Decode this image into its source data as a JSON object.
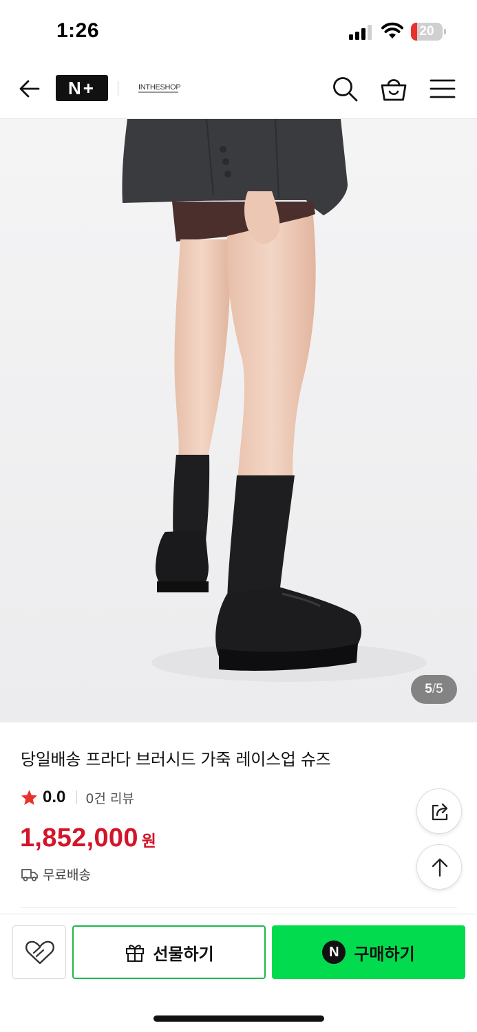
{
  "status_bar": {
    "time": "1:26",
    "battery_level": "20",
    "battery_fraction": 0.2,
    "icons": [
      "cellular-signal-icon",
      "wifi-icon",
      "battery-icon"
    ]
  },
  "nav": {
    "logo": "N+",
    "shop_name": "INTHESHOP",
    "icons": [
      "back-arrow-icon",
      "search-icon",
      "shopping-bag-icon",
      "hamburger-menu-icon"
    ]
  },
  "gallery": {
    "current": "5",
    "separator": "/",
    "total": "5"
  },
  "product": {
    "title": "당일배송 프라다 브러시드 가죽 레이스업 슈즈",
    "rating": "0.0",
    "review_count": "0건 리뷰",
    "price": "1,852,000",
    "currency": "원",
    "shipping": "무료배송"
  },
  "floating": {
    "icons": [
      "share-icon",
      "arrow-up-icon"
    ]
  },
  "actions": {
    "gift_label": "선물하기",
    "buy_badge": "N",
    "buy_label": "구매하기",
    "icons": [
      "heart-icon",
      "gift-icon"
    ]
  },
  "colors": {
    "price": "#d3152a",
    "buy_button": "#03db4f",
    "gift_border": "#1fb64c",
    "star": "#e8322b"
  }
}
